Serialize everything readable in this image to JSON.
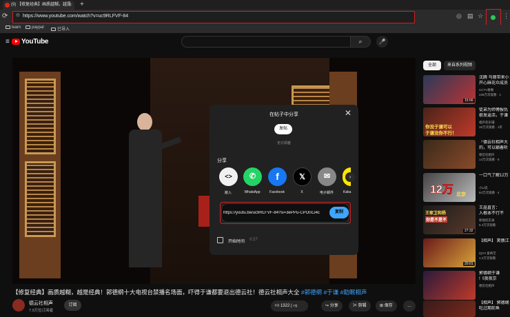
{
  "browser": {
    "tab_title": "(9) 【修复经典】画质越糊，越是",
    "tab_close": "×",
    "new_tab": "+",
    "url": "https://www.youtube.com/watch?v=uc9RLFVF-84",
    "bookmarks": [
      "learn",
      "paypal",
      "已导入"
    ]
  },
  "youtube": {
    "logo_text": "YouTube",
    "search_placeholder": ""
  },
  "share_dialog": {
    "title": "在帖子中分享",
    "post_button": "发帖",
    "no_subscribers": "无订阅者",
    "share_label": "分享",
    "targets": [
      "嵌入",
      "WhatsApp",
      "Facebook",
      "X",
      "电子邮件",
      "Kaka"
    ],
    "link": "https://youtu.be/uc9RLFVF-84?si=3ePPu-CPO0cJ4c",
    "copy_button": "复制",
    "start_time_label": "开始时间",
    "start_time_value": "0:27"
  },
  "video": {
    "title_main": "【修复经典】画质越糊，越是经典！郭德纲十大电视台禁播名场面，吓得于谦都要退出德云社！德云社相声大全 ",
    "hashtags": [
      "#郭德纲",
      "#于谦",
      "#助眠相声"
    ],
    "channel": "德云社相声",
    "subscribers": "7.9万位订阅者",
    "subscribe_button": "订阅",
    "likes": "1322",
    "share": "分享",
    "clip": "剪辑",
    "save": "保存",
    "more": "…"
  },
  "sidebar": {
    "chips": [
      "全部",
      "来自系列视频"
    ],
    "recommendations": [
      {
        "title": "沈腾 马丽带来小",
        "line2": "开心麻花众成员",
        "channel": "CCTV春晚",
        "meta": "239万次观看 · 1",
        "duration": "15:56"
      },
      {
        "title": "徒弟为师傅报仇",
        "line2": "歌发逼活，于谦",
        "channel": "相声欢乐铺",
        "meta": "26万次观看 · 1年",
        "duration": ""
      },
      {
        "title": "「德云社相声大",
        "line2": "的，可以躺着听",
        "channel": "德云社相声",
        "meta": "14万次观看 · 8",
        "duration": ""
      },
      {
        "title": "一口气了解12万",
        "line2": "",
        "channel": "小Li说",
        "meta": "84万次观看 · 4",
        "duration": ""
      },
      {
        "title": "王晶直言：",
        "line2": "入根本不行不",
        "channel": "新视纪实录",
        "meta": "5.4万次观看 ·",
        "duration": "27:32"
      },
      {
        "title": "【相声】 笑傲江",
        "line2": "",
        "channel": "iQIYI 爱奇艺",
        "meta": "1.2万次观看 ·",
        "duration": "20:01"
      },
      {
        "title": "郭德纲于谦",
        "line2": "!《夜夜京",
        "channel": "德云社相声",
        "meta": "",
        "duration": ""
      },
      {
        "title": "【相声】 郭德纲",
        "line2": "吃过期前鱼",
        "channel": "",
        "meta": "",
        "duration": ""
      }
    ],
    "thumb_texts": [
      "你没于谦可以",
      "于谦没你不行！",
      "北京",
      "王家卫和杨",
      "你是不是不"
    ]
  },
  "colors": {
    "accent_red": "#d62020",
    "link_blue": "#3ea6ff",
    "whatsapp": "#25d366",
    "facebook": "#1877f2"
  }
}
